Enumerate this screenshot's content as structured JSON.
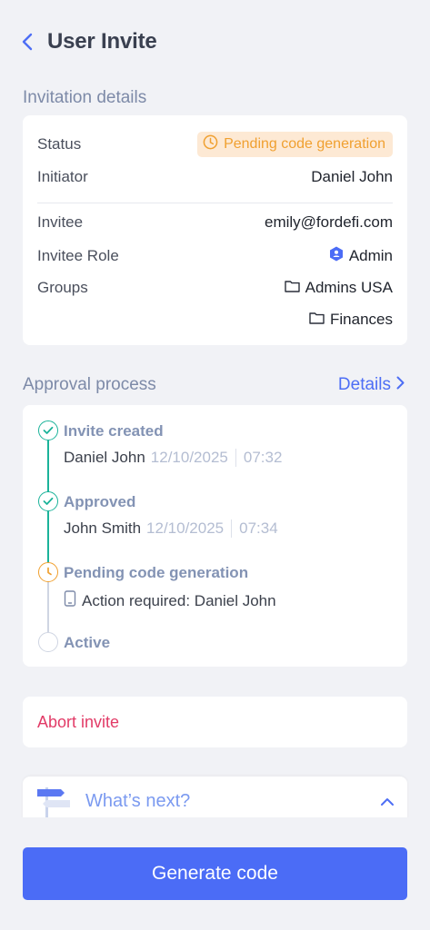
{
  "header": {
    "title": "User Invite"
  },
  "invitation": {
    "section_title": "Invitation details",
    "status_label": "Status",
    "status_value": "Pending code generation",
    "initiator_label": "Initiator",
    "initiator_value": "Daniel John",
    "invitee_label": "Invitee",
    "invitee_value": "emily@fordefi.com",
    "role_label": "Invitee Role",
    "role_value": "Admin",
    "groups_label": "Groups",
    "groups": [
      "Admins USA",
      "Finances"
    ]
  },
  "approval": {
    "section_title": "Approval process",
    "details_label": "Details",
    "steps": [
      {
        "title": "Invite created",
        "name": "Daniel John",
        "date": "12/10/2025",
        "time": "07:32"
      },
      {
        "title": "Approved",
        "name": "John Smith",
        "date": "12/10/2025",
        "time": "07:34"
      },
      {
        "title": "Pending code generation",
        "action": "Action required: Daniel John"
      },
      {
        "title": "Active"
      }
    ]
  },
  "abort": {
    "label": "Abort invite"
  },
  "whats_next": {
    "label": "What’s next?"
  },
  "footer": {
    "generate_label": "Generate code"
  },
  "colors": {
    "accent": "#4b6cf6",
    "success": "#1bb39a",
    "pending": "#f0a030",
    "danger": "#e23b67"
  }
}
